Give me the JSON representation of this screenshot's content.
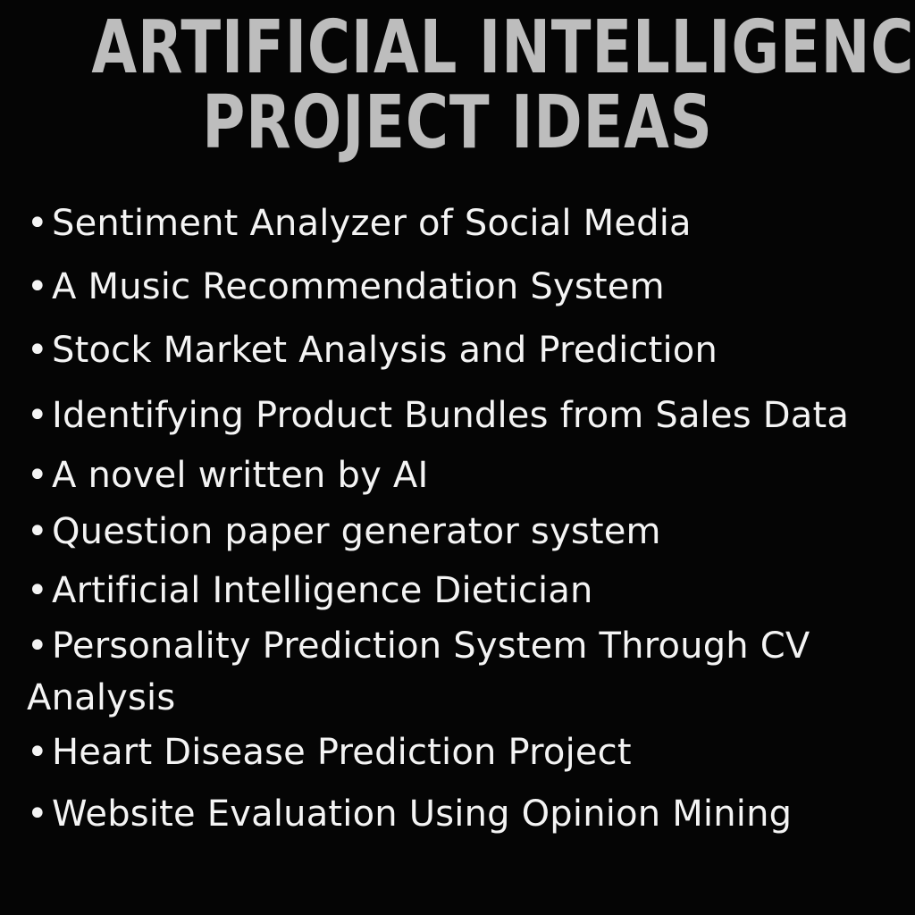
{
  "title": {
    "line1": "ARTIFICIAL INTELLIGENCE",
    "line2": "PROJECT IDEAS"
  },
  "bullet": "•",
  "items": [
    "Sentiment Analyzer of Social Media",
    "A Music Recommendation System",
    "Stock Market Analysis and Prediction",
    "Identifying Product Bundles from Sales Data",
    "A novel written by AI",
    "Question paper generator system",
    "Artificial Intelligence Dietician",
    "Personality Prediction System Through CV Analysis",
    "Heart Disease Prediction Project",
    "Website Evaluation Using Opinion Mining"
  ],
  "colors": {
    "background": "#050505",
    "title": "#bdbdbd",
    "text": "#f4f4f4"
  }
}
